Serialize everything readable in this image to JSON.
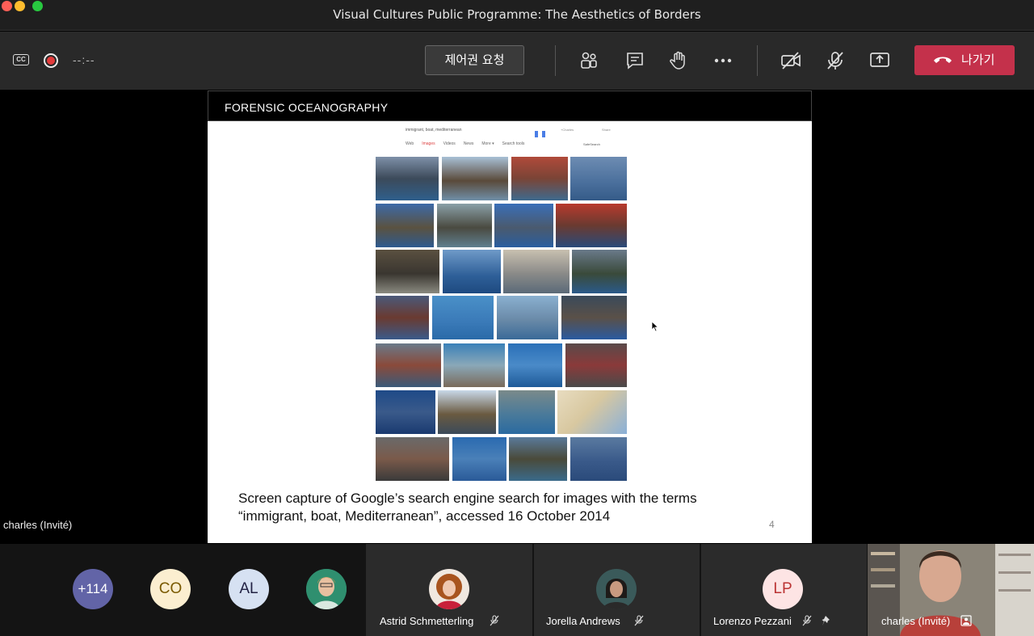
{
  "window": {
    "title": "Visual Cultures Public Programme: The Aesthetics of Borders"
  },
  "toolbar": {
    "cc_label": "CC",
    "timer": "--:--",
    "request_control": "제어권 요청",
    "leave_label": "나가기",
    "icons": [
      "participants-icon",
      "chat-icon",
      "raise-hand-icon",
      "more-icon",
      "camera-off-icon",
      "mic-off-icon",
      "share-icon"
    ]
  },
  "slide": {
    "title": "FORENSIC OCEANOGRAPHY",
    "search_query": "immigrant, boat, mediterranean",
    "search_extra1": "+Charles",
    "search_extra2": "Share",
    "search_tabs": [
      "Web",
      "Images",
      "Videos",
      "News",
      "More ▾",
      "Search tools"
    ],
    "safe_search": "SafeSearch",
    "caption_line1": "Screen capture of Google’s search engine search for images with the terms",
    "caption_line2": "“immigrant, boat, Mediterranean”, accessed 16 October 2014",
    "page_number": "4"
  },
  "presenter_label": "charles (Invité)",
  "participants": {
    "overflow": "+114",
    "initials": [
      "CO",
      "AL"
    ],
    "tiles": [
      {
        "name": "Astrid Schmetterling"
      },
      {
        "name": "Jorella Andrews"
      },
      {
        "name": "Lorenzo Pezzani",
        "initials": "LP"
      },
      {
        "name": "charles (Invité)"
      }
    ]
  },
  "colors": {
    "leave": "#c4314b",
    "accent": "#6264a7"
  }
}
